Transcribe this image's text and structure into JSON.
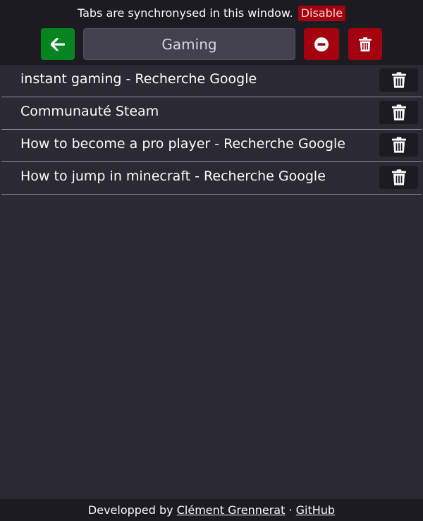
{
  "sync": {
    "text": "Tabs are synchronysed in this window.",
    "disable_label": "Disable"
  },
  "toolbar": {
    "back_icon": "arrow-left-icon",
    "group_name_value": "Gaming",
    "remove_icon": "minus-circle-icon",
    "delete_icon": "trash-icon"
  },
  "tabs": [
    {
      "title": "instant gaming - Recherche Google"
    },
    {
      "title": "Communauté Steam"
    },
    {
      "title": "How to become a pro player - Recherche Google"
    },
    {
      "title": "How to jump in minecraft - Recherche Google"
    }
  ],
  "footer": {
    "prefix": "Developped by ",
    "author": "Clément Grennerat",
    "separator": " · ",
    "github": "GitHub"
  },
  "colors": {
    "background": "#2b2a33",
    "header": "#1c1b22",
    "back_button": "#05851f",
    "danger_button": "#a4000f",
    "input": "#42414d"
  }
}
